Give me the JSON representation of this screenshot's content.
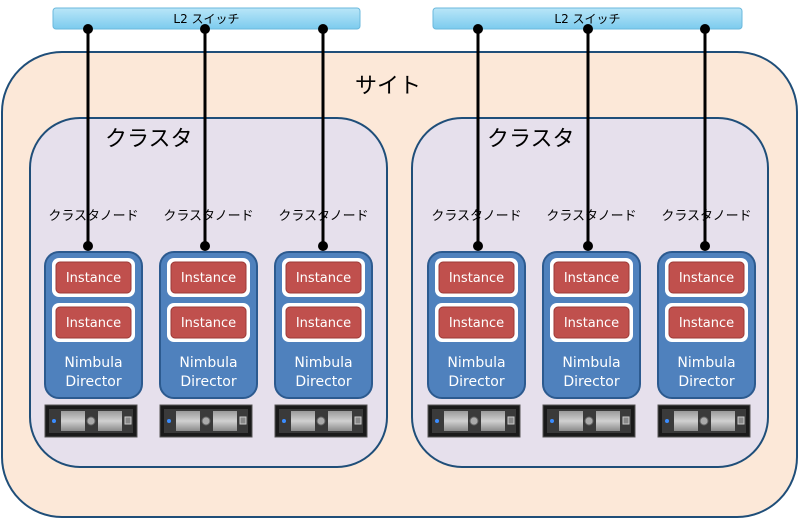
{
  "site": {
    "label": "サイト"
  },
  "switches": [
    {
      "label": "L2 スイッチ"
    },
    {
      "label": "L2 スイッチ"
    }
  ],
  "clusters": [
    {
      "label": "クラスタ",
      "nodes": [
        {
          "label": "クラスタノード",
          "instances": [
            "Instance",
            "Instance"
          ],
          "director": [
            "Nimbula",
            "Director"
          ]
        },
        {
          "label": "クラスタノード",
          "instances": [
            "Instance",
            "Instance"
          ],
          "director": [
            "Nimbula",
            "Director"
          ]
        },
        {
          "label": "クラスタノード",
          "instances": [
            "Instance",
            "Instance"
          ],
          "director": [
            "Nimbula",
            "Director"
          ]
        }
      ]
    },
    {
      "label": "クラスタ",
      "nodes": [
        {
          "label": "クラスタノード",
          "instances": [
            "Instance",
            "Instance"
          ],
          "director": [
            "Nimbula",
            "Director"
          ]
        },
        {
          "label": "クラスタノード",
          "instances": [
            "Instance",
            "Instance"
          ],
          "director": [
            "Nimbula",
            "Director"
          ]
        },
        {
          "label": "クラスタノード",
          "instances": [
            "Instance",
            "Instance"
          ],
          "director": [
            "Nimbula",
            "Director"
          ]
        }
      ]
    }
  ],
  "colors": {
    "site_fill": "#fce8d8",
    "cluster_fill": "#e6e0ec",
    "border": "#1f4e79",
    "node_fill": "#4f81bd",
    "instance_fill": "#c0504d",
    "switch_fill": "#8fd3f0"
  }
}
